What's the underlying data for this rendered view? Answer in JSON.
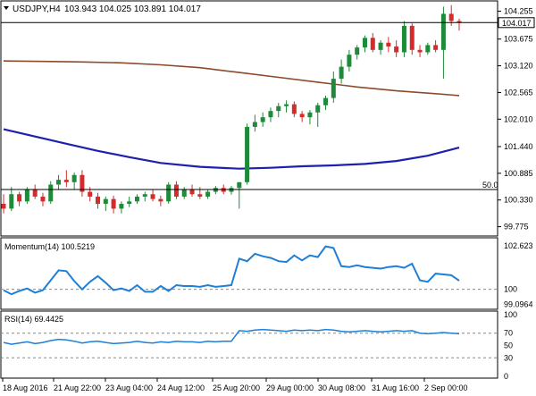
{
  "chart_data": [
    {
      "type": "candlestick",
      "title": "USDJPY,H4",
      "ohlc_label": "103.943 104.025 103.891 104.017",
      "current_price": "104.017",
      "ylim": [
        99.6,
        104.45
      ],
      "y_ticks": [
        "104.255",
        "103.675",
        "103.120",
        "102.565",
        "102.010",
        "101.440",
        "100.885",
        "100.330",
        "99.775"
      ],
      "level_marker": "50.0",
      "candles": [
        [
          100.25,
          100.45,
          100.05,
          100.15
        ],
        [
          100.15,
          100.6,
          100.1,
          100.45
        ],
        [
          100.45,
          100.5,
          100.2,
          100.3
        ],
        [
          100.3,
          100.6,
          100.25,
          100.55
        ],
        [
          100.55,
          100.65,
          100.35,
          100.4
        ],
        [
          100.4,
          100.48,
          100.2,
          100.3
        ],
        [
          100.3,
          100.72,
          100.25,
          100.65
        ],
        [
          100.65,
          100.85,
          100.55,
          100.75
        ],
        [
          100.75,
          100.95,
          100.6,
          100.7
        ],
        [
          100.7,
          100.9,
          100.55,
          100.85
        ],
        [
          100.85,
          100.95,
          100.4,
          100.5
        ],
        [
          100.5,
          100.6,
          100.3,
          100.4
        ],
        [
          100.4,
          100.48,
          100.15,
          100.25
        ],
        [
          100.25,
          100.4,
          100.1,
          100.35
        ],
        [
          100.35,
          100.42,
          100.05,
          100.15
        ],
        [
          100.15,
          100.3,
          100.05,
          100.25
        ],
        [
          100.25,
          100.4,
          100.18,
          100.3
        ],
        [
          100.3,
          100.45,
          100.25,
          100.4
        ],
        [
          100.4,
          100.5,
          100.3,
          100.45
        ],
        [
          100.45,
          100.55,
          100.3,
          100.35
        ],
        [
          100.35,
          100.42,
          100.2,
          100.3
        ],
        [
          100.3,
          100.7,
          100.25,
          100.65
        ],
        [
          100.65,
          100.72,
          100.35,
          100.4
        ],
        [
          100.4,
          100.6,
          100.35,
          100.55
        ],
        [
          100.55,
          100.65,
          100.4,
          100.45
        ],
        [
          100.45,
          100.6,
          100.35,
          100.4
        ],
        [
          100.4,
          100.55,
          100.35,
          100.5
        ],
        [
          100.5,
          100.62,
          100.45,
          100.58
        ],
        [
          100.58,
          100.65,
          100.45,
          100.5
        ],
        [
          100.5,
          100.62,
          100.44,
          100.58
        ],
        [
          100.58,
          100.7,
          100.15,
          100.7
        ],
        [
          100.7,
          101.92,
          100.65,
          101.85
        ],
        [
          101.85,
          102.1,
          101.75,
          101.95
        ],
        [
          101.95,
          102.15,
          101.85,
          102.05
        ],
        [
          102.05,
          102.25,
          101.95,
          102.18
        ],
        [
          102.18,
          102.35,
          102.05,
          102.28
        ],
        [
          102.28,
          102.4,
          102.15,
          102.32
        ],
        [
          102.32,
          102.38,
          102.05,
          102.12
        ],
        [
          102.12,
          102.18,
          101.95,
          102.05
        ],
        [
          102.05,
          102.2,
          101.9,
          102.15
        ],
        [
          102.15,
          102.35,
          101.85,
          102.3
        ],
        [
          102.3,
          102.5,
          102.2,
          102.45
        ],
        [
          102.45,
          103.0,
          102.35,
          102.85
        ],
        [
          102.85,
          103.25,
          102.75,
          103.1
        ],
        [
          103.1,
          103.45,
          103.0,
          103.35
        ],
        [
          103.35,
          103.55,
          103.25,
          103.5
        ],
        [
          103.5,
          103.75,
          103.4,
          103.7
        ],
        [
          103.7,
          103.8,
          103.4,
          103.45
        ],
        [
          103.45,
          103.65,
          103.35,
          103.6
        ],
        [
          103.6,
          103.72,
          103.4,
          103.52
        ],
        [
          103.52,
          103.65,
          103.3,
          103.4
        ],
        [
          103.4,
          104.05,
          103.3,
          103.95
        ],
        [
          103.95,
          104.0,
          103.35,
          103.45
        ],
        [
          103.45,
          103.55,
          103.3,
          103.4
        ],
        [
          103.4,
          103.6,
          103.35,
          103.55
        ],
        [
          103.55,
          103.65,
          103.4,
          103.45
        ],
        [
          103.45,
          104.35,
          102.85,
          104.2
        ],
        [
          104.2,
          104.38,
          103.95,
          104.05
        ],
        [
          104.05,
          104.1,
          103.85,
          104.02
        ]
      ],
      "series": [
        {
          "name": "slow-ma",
          "color": "#8b4a2b",
          "points": [
            [
              0,
              103.22
            ],
            [
              5,
              103.21
            ],
            [
              10,
              103.2
            ],
            [
              15,
              103.18
            ],
            [
              20,
              103.14
            ],
            [
              25,
              103.08
            ],
            [
              30,
              102.98
            ],
            [
              35,
              102.88
            ],
            [
              40,
              102.78
            ],
            [
              45,
              102.68
            ],
            [
              50,
              102.6
            ],
            [
              55,
              102.54
            ],
            [
              58,
              102.5
            ]
          ]
        },
        {
          "name": "fast-ma",
          "color": "#1f1fb0",
          "points": [
            [
              0,
              101.8
            ],
            [
              4,
              101.65
            ],
            [
              8,
              101.5
            ],
            [
              12,
              101.35
            ],
            [
              16,
              101.22
            ],
            [
              20,
              101.1
            ],
            [
              25,
              101.02
            ],
            [
              30,
              100.98
            ],
            [
              34,
              101.0
            ],
            [
              38,
              101.03
            ],
            [
              42,
              101.05
            ],
            [
              46,
              101.08
            ],
            [
              50,
              101.14
            ],
            [
              54,
              101.25
            ],
            [
              58,
              101.42
            ]
          ]
        }
      ]
    },
    {
      "type": "line",
      "title": "Momentum(14) 100.5219",
      "ylim": [
        98.9,
        102.9
      ],
      "y_ticks": [
        "102.623",
        "100",
        "99.0964"
      ],
      "reference_level": 100,
      "series": [
        {
          "name": "Momentum",
          "color": "#1e7fd6",
          "values": [
            99.95,
            99.7,
            99.9,
            100.05,
            99.8,
            99.95,
            100.55,
            101.15,
            101.1,
            100.5,
            100.0,
            100.45,
            100.8,
            100.4,
            99.95,
            100.05,
            99.9,
            100.25,
            99.85,
            99.85,
            100.2,
            99.9,
            100.25,
            100.2,
            100.2,
            100.15,
            100.25,
            100.15,
            100.2,
            100.25,
            101.85,
            101.7,
            102.15,
            102.0,
            101.9,
            101.7,
            101.65,
            102.05,
            101.75,
            102.05,
            101.95,
            102.6,
            102.5,
            101.4,
            101.35,
            101.45,
            101.35,
            101.3,
            101.25,
            101.35,
            101.4,
            101.3,
            101.55,
            100.55,
            100.45,
            100.95,
            100.9,
            100.85,
            100.52
          ]
        }
      ]
    },
    {
      "type": "line",
      "title": "RSI(14) 69.4425",
      "ylim": [
        0,
        100
      ],
      "y_ticks": [
        "100",
        "70",
        "50",
        "30",
        "0"
      ],
      "reference_levels": [
        70,
        30
      ],
      "series": [
        {
          "name": "RSI",
          "color": "#1e7fd6",
          "values": [
            55,
            52,
            54,
            56,
            53,
            55,
            58,
            60,
            59,
            57,
            54,
            56,
            57,
            55,
            53,
            54,
            55,
            57,
            55,
            54,
            56,
            55,
            57,
            56,
            56,
            55,
            57,
            56,
            57,
            57,
            74,
            73,
            75,
            76,
            75,
            74,
            73,
            75,
            74,
            75,
            74,
            76,
            75,
            73,
            72,
            73,
            74,
            73,
            72,
            73,
            74,
            73,
            74,
            70,
            69,
            70,
            71,
            70,
            69
          ]
        }
      ]
    }
  ],
  "x_labels": [
    "18 Aug 2016",
    "21 Aug 22:00",
    "23 Aug 04:00",
    "24 Aug 12:00",
    "25 Aug 20:00",
    "29 Aug 00:00",
    "30 Aug 08:00",
    "31 Aug 16:00",
    "2 Sep 00:00"
  ],
  "colors": {
    "up": "#1f8a3a",
    "down": "#d62b2b",
    "grid": "#000000",
    "price_label_bg": "#ffffff"
  }
}
